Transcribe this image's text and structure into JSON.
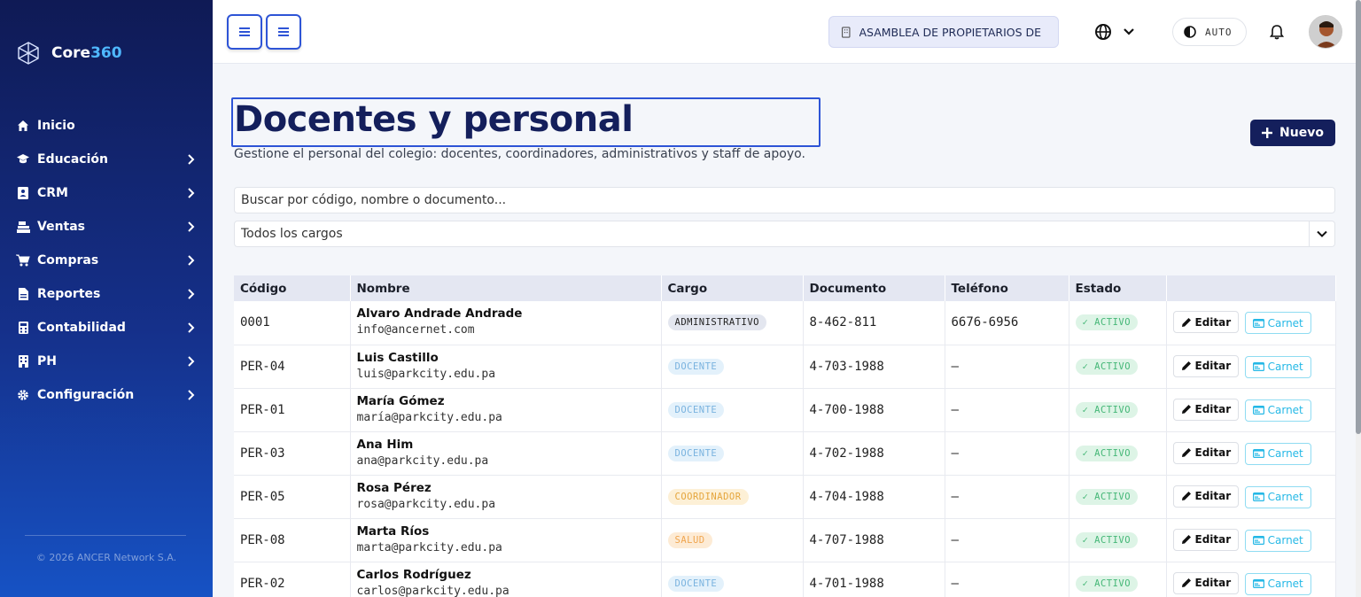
{
  "brand": {
    "name_main": "Core",
    "name_accent": "360"
  },
  "sidebar": {
    "items": [
      {
        "label": "Inicio",
        "icon": "home-icon",
        "has_submenu": false
      },
      {
        "label": "Educación",
        "icon": "graduation-cap-icon",
        "has_submenu": true
      },
      {
        "label": "CRM",
        "icon": "address-book-icon",
        "has_submenu": true
      },
      {
        "label": "Ventas",
        "icon": "cash-register-icon",
        "has_submenu": true
      },
      {
        "label": "Compras",
        "icon": "shopping-cart-icon",
        "has_submenu": true
      },
      {
        "label": "Reportes",
        "icon": "file-icon",
        "has_submenu": true
      },
      {
        "label": "Contabilidad",
        "icon": "calculator-icon",
        "has_submenu": true
      },
      {
        "label": "PH",
        "icon": "building-icon",
        "has_submenu": true
      },
      {
        "label": "Configuración",
        "icon": "gear-icon",
        "has_submenu": true
      }
    ],
    "copyright": "© 2026 ANCER Network S.A."
  },
  "topbar": {
    "organization": "ASAMBLEA DE PROPIETARIOS DE ...",
    "theme_label": "AUTO"
  },
  "page": {
    "title": "Docentes y personal",
    "subtitle": "Gestione el personal del colegio: docentes, coordinadores, administrativos y staff de apoyo.",
    "new_button": "Nuevo",
    "search_placeholder": "Buscar por código, nombre o documento...",
    "filter_selected": "Todos los cargos"
  },
  "table": {
    "headers": [
      "Código",
      "Nombre",
      "Cargo",
      "Documento",
      "Teléfono",
      "Estado",
      ""
    ],
    "edit_label": "Editar",
    "carnet_label": "Carnet",
    "rows": [
      {
        "code": "0001",
        "name": "Alvaro Andrade Andrade",
        "email": "info@ancernet.com",
        "role": "ADMINISTRATIVO",
        "role_class": "badge-admin",
        "document": "8-462-811",
        "phone": "6676-6956",
        "status": "✓ ACTIVO"
      },
      {
        "code": "PER-04",
        "name": "Luis Castillo",
        "email": "luis@parkcity.edu.pa",
        "role": "DOCENTE",
        "role_class": "badge-docente",
        "document": "4-703-1988",
        "phone": "—",
        "status": "✓ ACTIVO"
      },
      {
        "code": "PER-01",
        "name": "María Gómez",
        "email": "maría@parkcity.edu.pa",
        "role": "DOCENTE",
        "role_class": "badge-docente",
        "document": "4-700-1988",
        "phone": "—",
        "status": "✓ ACTIVO"
      },
      {
        "code": "PER-03",
        "name": "Ana Him",
        "email": "ana@parkcity.edu.pa",
        "role": "DOCENTE",
        "role_class": "badge-docente",
        "document": "4-702-1988",
        "phone": "—",
        "status": "✓ ACTIVO"
      },
      {
        "code": "PER-05",
        "name": "Rosa Pérez",
        "email": "rosa@parkcity.edu.pa",
        "role": "COORDINADOR",
        "role_class": "badge-coord",
        "document": "4-704-1988",
        "phone": "—",
        "status": "✓ ACTIVO"
      },
      {
        "code": "PER-08",
        "name": "Marta Ríos",
        "email": "marta@parkcity.edu.pa",
        "role": "SALUD",
        "role_class": "badge-salud",
        "document": "4-707-1988",
        "phone": "—",
        "status": "✓ ACTIVO"
      },
      {
        "code": "PER-02",
        "name": "Carlos Rodríguez",
        "email": "carlos@parkcity.edu.pa",
        "role": "DOCENTE",
        "role_class": "badge-docente",
        "document": "4-701-1988",
        "phone": "—",
        "status": "✓ ACTIVO"
      }
    ]
  },
  "colors": {
    "accent": "#2e54d6",
    "title": "#141f5c",
    "sidebar_top": "#0f1a55",
    "sidebar_bottom": "#1652c4"
  }
}
